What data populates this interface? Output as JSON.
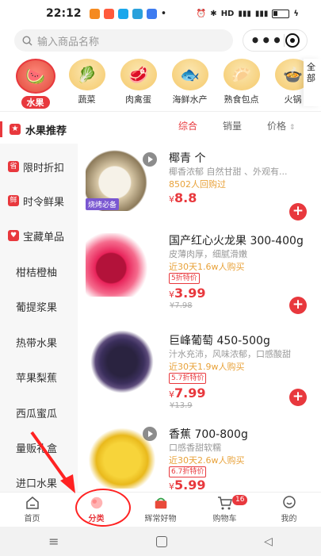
{
  "status": {
    "time": "22:12",
    "right_text": "HD"
  },
  "search": {
    "placeholder": "输入商品名称"
  },
  "categories": [
    {
      "label": "水果",
      "emoji": "🍉"
    },
    {
      "label": "蔬菜",
      "emoji": "🥬"
    },
    {
      "label": "肉禽蛋",
      "emoji": "🥩"
    },
    {
      "label": "海鲜水产",
      "emoji": "🐟"
    },
    {
      "label": "熟食包点",
      "emoji": "🥟"
    },
    {
      "label": "火锅",
      "emoji": "🍲"
    }
  ],
  "cat_all": "全部",
  "sidebar": {
    "head": "水果推荐",
    "items": [
      {
        "label": "限时折扣",
        "tag": "省"
      },
      {
        "label": "时令鲜果",
        "tag": "鲜"
      },
      {
        "label": "宝藏单品",
        "tag": "♥"
      },
      {
        "label": "柑桔橙柚"
      },
      {
        "label": "葡提浆果"
      },
      {
        "label": "热带水果"
      },
      {
        "label": "苹果梨蕉"
      },
      {
        "label": "西瓜蜜瓜"
      },
      {
        "label": "量贩礼盒"
      },
      {
        "label": "进口水果"
      }
    ]
  },
  "sort": {
    "comprehensive": "综合",
    "sales": "销量",
    "price": "价格"
  },
  "products": [
    {
      "name": "椰青 个",
      "desc": "椰香浓郁 自然甘甜 、外观有...",
      "sold": "8502人回购过",
      "price": "8.8",
      "badge": "烧烤必备"
    },
    {
      "name": "国产红心火龙果 300-400g",
      "desc": "皮薄肉厚，细腻滑嫩",
      "sold": "近30天1.6w人购买",
      "discount": "5折特价",
      "price": "3.99",
      "orig": "¥7.98"
    },
    {
      "name": "巨峰葡萄 450-500g",
      "desc": "汁水充沛，风味浓郁，口感酸甜",
      "sold": "近30天1.9w人购买",
      "discount": "5.7折特价",
      "price": "7.99",
      "orig": "¥13.9"
    },
    {
      "name": "香蕉 700-800g",
      "desc": "口感香甜软糯",
      "sold": "近30天2.6w人购买",
      "discount": "6.7折特价",
      "price": "5.99"
    }
  ],
  "currency": "¥",
  "tabs": [
    {
      "label": "首页"
    },
    {
      "label": "分类"
    },
    {
      "label": "辉常好物"
    },
    {
      "label": "购物车",
      "badge": "16"
    },
    {
      "label": "我的"
    }
  ]
}
